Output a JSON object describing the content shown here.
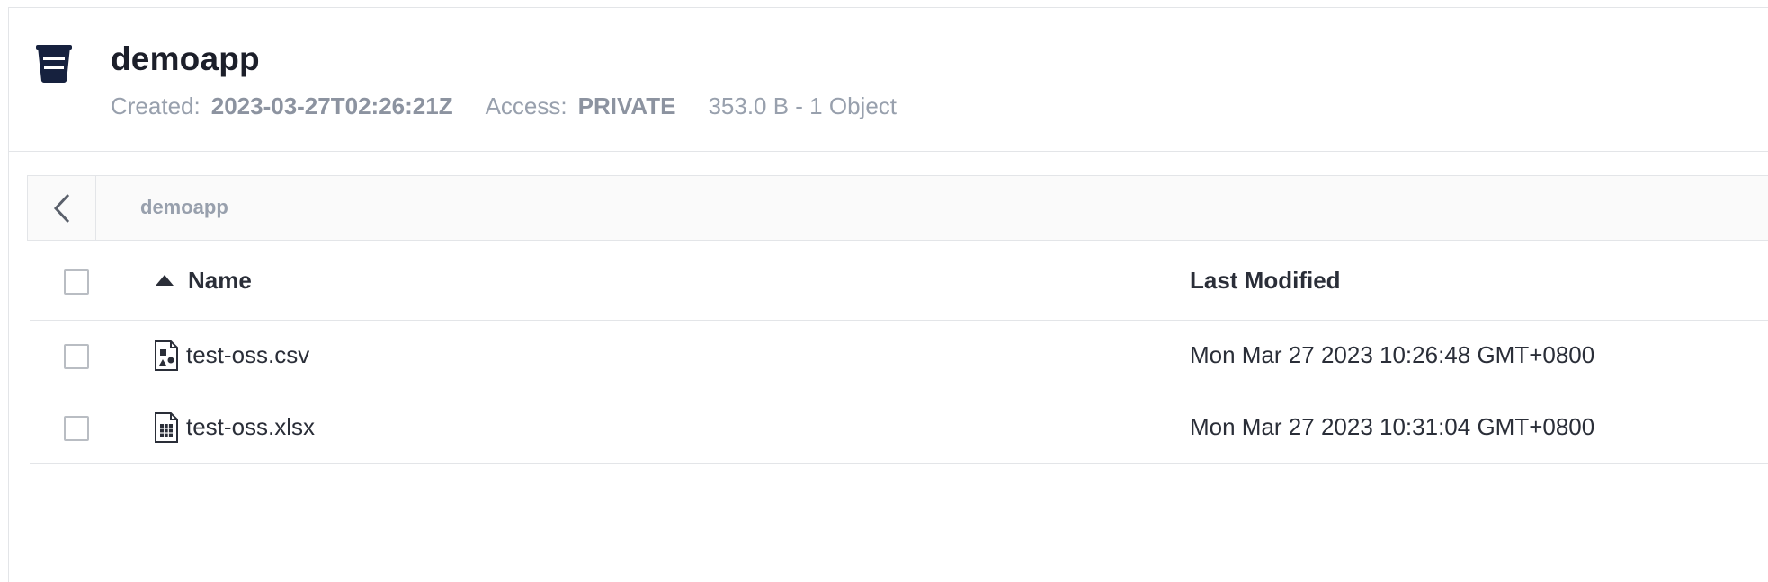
{
  "bucket": {
    "name": "demoapp",
    "created_label": "Created:",
    "created_value": "2023-03-27T02:26:21Z",
    "access_label": "Access:",
    "access_value": "PRIVATE",
    "summary": "353.0 B - 1 Object"
  },
  "breadcrumb": {
    "path": "demoapp"
  },
  "table": {
    "columns": {
      "name": "Name",
      "modified": "Last Modified"
    },
    "rows": [
      {
        "name": "test-oss.csv",
        "modified": "Mon Mar 27 2023 10:26:48 GMT+0800",
        "icon": "file-media-icon"
      },
      {
        "name": "test-oss.xlsx",
        "modified": "Mon Mar 27 2023 10:31:04 GMT+0800",
        "icon": "file-spreadsheet-icon"
      }
    ]
  },
  "colors": {
    "brand_navy": "#16213e",
    "muted_text": "#98a0ad",
    "border": "#e3e5e8"
  }
}
